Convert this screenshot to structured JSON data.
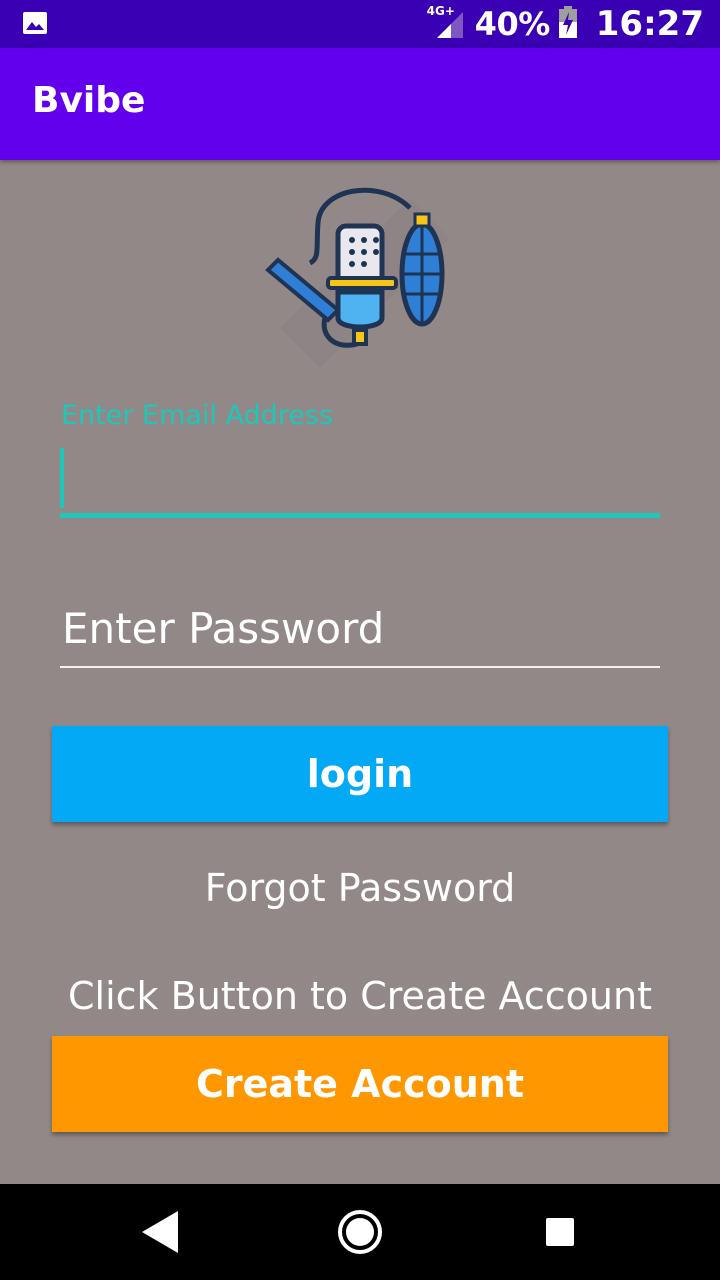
{
  "status_bar": {
    "network_type": "4G+",
    "battery_percent": "40%",
    "time": "16:27",
    "icons": [
      "gallery-icon",
      "signal-icon",
      "battery-charging-icon"
    ]
  },
  "app_bar": {
    "title": "Bvibe"
  },
  "logo": {
    "icon": "podcast-microphone-icon"
  },
  "login_form": {
    "email_label": "Enter Email Address",
    "email_value": "",
    "password_placeholder": "Enter Password",
    "login_button": "login",
    "forgot_password": "Forgot Password",
    "create_hint": "Click Button to Create Account",
    "create_button": "Create Account"
  },
  "colors": {
    "status_bar": "#3a00b3",
    "app_bar": "#6200ee",
    "background": "#928888",
    "accent_teal": "#1ec8b8",
    "login_button": "#03a9f4",
    "create_button": "#ff9800"
  },
  "nav_bar": {
    "icons": [
      "back-icon",
      "home-icon",
      "recents-icon"
    ]
  }
}
